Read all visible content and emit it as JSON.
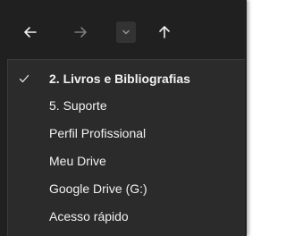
{
  "navigation": {
    "back_icon": "arrow-left-icon",
    "forward_icon": "arrow-right-icon",
    "recent_icon": "chevron-down-icon",
    "up_icon": "arrow-up-icon"
  },
  "history_menu": {
    "items": [
      {
        "label": "2. Livros e Bibliografias",
        "selected": true
      },
      {
        "label": "5. Suporte",
        "selected": false
      },
      {
        "label": "Perfil Profissional",
        "selected": false
      },
      {
        "label": "Meu Drive",
        "selected": false
      },
      {
        "label": "Google Drive (G:)",
        "selected": false
      },
      {
        "label": "Acesso rápido",
        "selected": false
      }
    ]
  },
  "colors": {
    "background": "#202020",
    "menu_background": "#2b2b2b",
    "text": "#f2f2f2",
    "disabled_icon": "#7a7a7a"
  }
}
